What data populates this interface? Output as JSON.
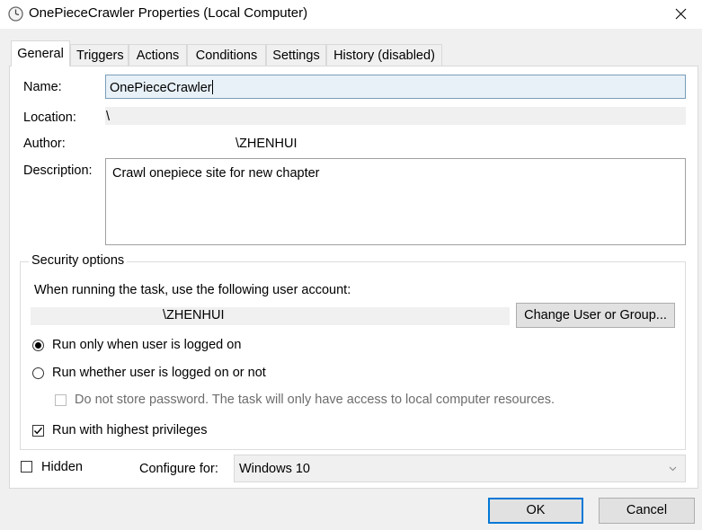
{
  "window": {
    "title": "OnePieceCrawler Properties (Local Computer)"
  },
  "tabs": [
    {
      "label": "General"
    },
    {
      "label": "Triggers"
    },
    {
      "label": "Actions"
    },
    {
      "label": "Conditions"
    },
    {
      "label": "Settings"
    },
    {
      "label": "History (disabled)"
    }
  ],
  "general": {
    "name_label": "Name:",
    "name_value": "OnePieceCrawler",
    "location_label": "Location:",
    "location_value": "\\",
    "author_label": "Author:",
    "author_value": "\\ZHENHUI",
    "description_label": "Description:",
    "description_value": "Crawl onepiece site for new chapter"
  },
  "security": {
    "group_title": "Security options",
    "account_prompt": "When running the task, use the following user account:",
    "account_value": "\\ZHENHUI",
    "change_user_label": "Change User or Group...",
    "radio_logged_on_label": "Run only when user is logged on",
    "radio_logged_on_selected": true,
    "radio_whether_label": "Run whether user is logged on or not",
    "radio_whether_selected": false,
    "no_store_password_label": "Do not store password.  The task will only have access to local computer resources.",
    "highest_privileges_label": "Run with highest privileges",
    "highest_privileges_checked": true
  },
  "bottom": {
    "hidden_label": "Hidden",
    "hidden_checked": false,
    "configure_label": "Configure for:",
    "configure_value": "Windows 10"
  },
  "buttons": {
    "ok_label": "OK",
    "cancel_label": "Cancel"
  },
  "colors": {
    "accent": "#0078d7",
    "tab_border": "#d9d9d9",
    "disabled_text": "#6d6d6d"
  }
}
